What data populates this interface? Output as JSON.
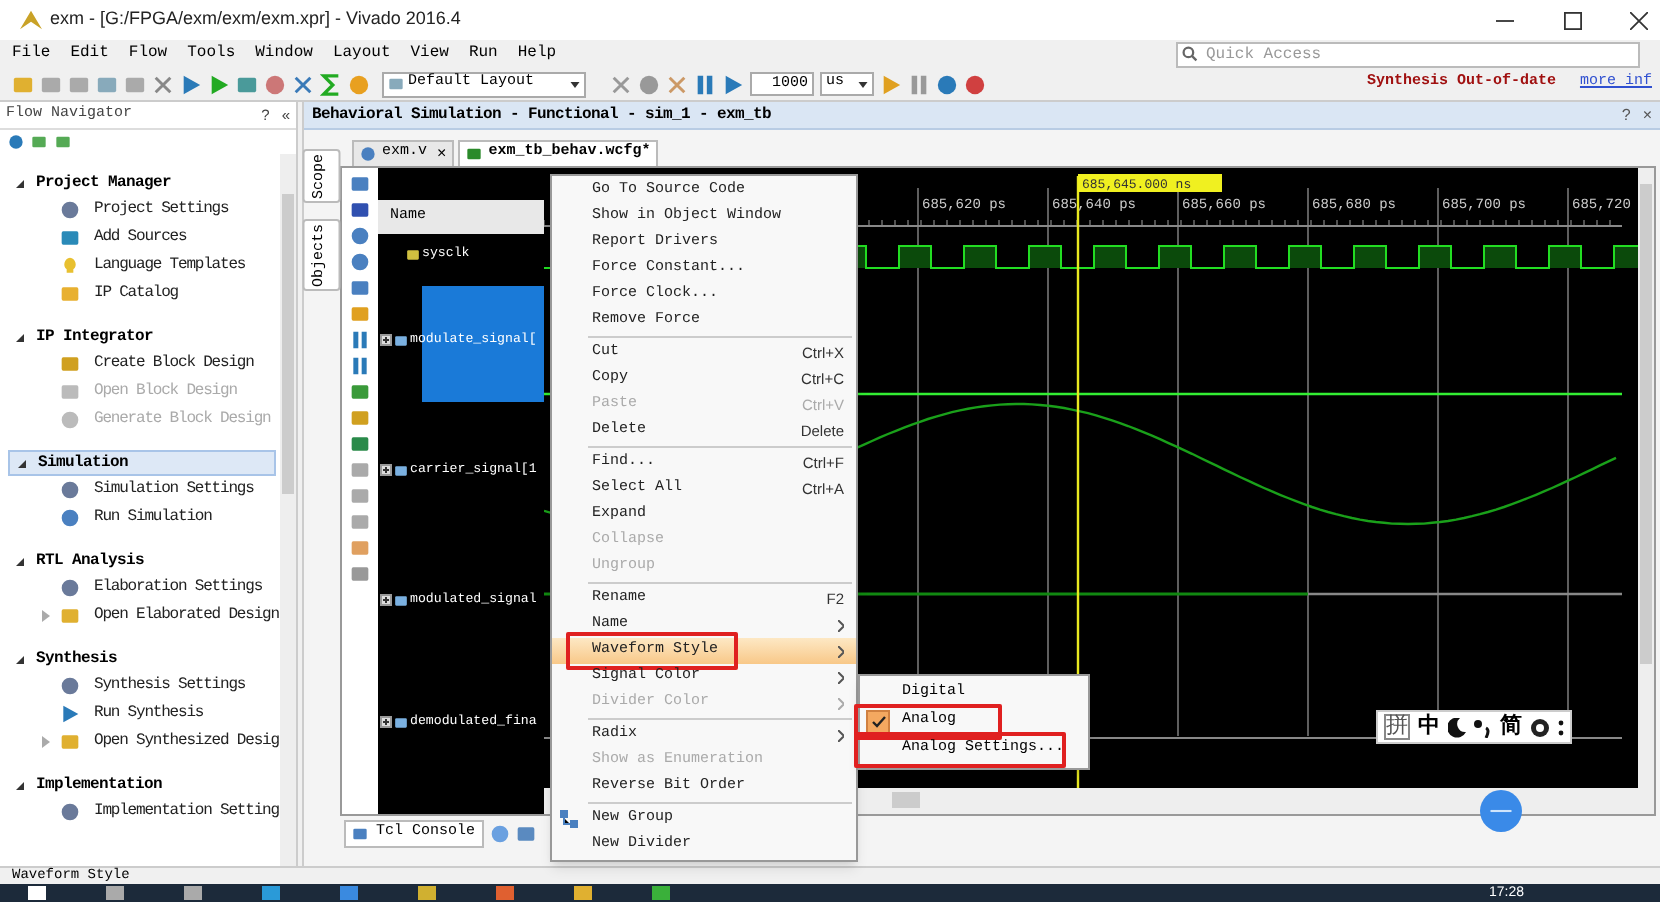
{
  "window": {
    "title": "exm - [G:/FPGA/exm/exm/exm.xpr] - Vivado 2016.4"
  },
  "menu_bar": [
    "File",
    "Edit",
    "Flow",
    "Tools",
    "Window",
    "Layout",
    "View",
    "Run",
    "Help"
  ],
  "quick_access": {
    "placeholder": "Quick Access"
  },
  "toolbar": {
    "layout": "Default Layout",
    "run_time": "1000",
    "run_unit": "us"
  },
  "status_notice": {
    "text": "Synthesis Out-of-date",
    "link": "more inf"
  },
  "flow_navigator": {
    "title": "Flow Navigator",
    "help": "?",
    "collapse": "«",
    "sections": [
      {
        "label": "Project Manager",
        "selected": false,
        "children": [
          {
            "label": "Project Settings",
            "disabled": false,
            "expandable": false
          },
          {
            "label": "Add Sources",
            "disabled": false,
            "expandable": false
          },
          {
            "label": "Language Templates",
            "disabled": false,
            "expandable": false
          },
          {
            "label": "IP Catalog",
            "disabled": false,
            "expandable": false
          }
        ]
      },
      {
        "label": "IP Integrator",
        "selected": false,
        "children": [
          {
            "label": "Create Block Design",
            "disabled": false,
            "expandable": false
          },
          {
            "label": "Open Block Design",
            "disabled": true,
            "expandable": false
          },
          {
            "label": "Generate Block Design",
            "disabled": true,
            "expandable": false
          }
        ]
      },
      {
        "label": "Simulation",
        "selected": true,
        "children": [
          {
            "label": "Simulation Settings",
            "disabled": false,
            "expandable": false
          },
          {
            "label": "Run Simulation",
            "disabled": false,
            "expandable": false
          }
        ]
      },
      {
        "label": "RTL Analysis",
        "selected": false,
        "children": [
          {
            "label": "Elaboration Settings",
            "disabled": false,
            "expandable": false
          },
          {
            "label": "Open Elaborated Design",
            "disabled": false,
            "expandable": true
          }
        ]
      },
      {
        "label": "Synthesis",
        "selected": false,
        "children": [
          {
            "label": "Synthesis Settings",
            "disabled": false,
            "expandable": false
          },
          {
            "label": "Run Synthesis",
            "disabled": false,
            "expandable": false
          },
          {
            "label": "Open Synthesized Desig",
            "disabled": false,
            "expandable": true
          }
        ]
      },
      {
        "label": "Implementation",
        "selected": false,
        "children": [
          {
            "label": "Implementation Setting",
            "disabled": false,
            "expandable": false
          }
        ]
      }
    ]
  },
  "simulation_panel": {
    "title": "Behavioral Simulation - Functional - sim_1 - exm_tb",
    "help": "?",
    "close": "×",
    "side_tabs": [
      "Scope",
      "Objects"
    ],
    "tabs": [
      {
        "label": "exm.v",
        "selected": false,
        "close": "×"
      },
      {
        "label": "exm_tb_behav.wcfg*",
        "selected": true
      }
    ],
    "name_header": "Name",
    "signals": [
      {
        "name": "sysclk",
        "selected": false,
        "expandable": false
      },
      {
        "name": "modulate_signal[",
        "selected": true,
        "expandable": true
      },
      {
        "name": "carrier_signal[1",
        "selected": false,
        "expandable": true
      },
      {
        "name": "modulated_signal",
        "selected": false,
        "expandable": true
      },
      {
        "name": "demodulated_fina",
        "selected": false,
        "expandable": true
      }
    ],
    "cursor_time": "685,645.000 ns",
    "time_ticks": [
      "685,620 ps",
      "685,640 ps",
      "685,660 ps",
      "685,680 ps",
      "685,700 ps",
      "685,720"
    ],
    "bottom_tabs": [
      "Tcl Console"
    ]
  },
  "context_menu": [
    {
      "kind": "item",
      "label": "Go To Source Code",
      "disabled": false,
      "selected": false,
      "annotated": false
    },
    {
      "kind": "item",
      "label": "Show in Object Window",
      "disabled": false,
      "selected": false,
      "annotated": false
    },
    {
      "kind": "item",
      "label": "Report Drivers",
      "disabled": false,
      "selected": false,
      "annotated": false
    },
    {
      "kind": "item",
      "label": "Force Constant...",
      "disabled": false,
      "selected": false,
      "annotated": false
    },
    {
      "kind": "item",
      "label": "Force Clock...",
      "disabled": false,
      "selected": false,
      "annotated": false
    },
    {
      "kind": "item",
      "label": "Remove Force",
      "disabled": false,
      "selected": false,
      "annotated": false
    },
    {
      "kind": "separator"
    },
    {
      "kind": "item",
      "label": "Cut",
      "shortcut": "Ctrl+X",
      "disabled": false,
      "selected": false,
      "annotated": false
    },
    {
      "kind": "item",
      "label": "Copy",
      "shortcut": "Ctrl+C",
      "disabled": false,
      "selected": false,
      "annotated": false
    },
    {
      "kind": "item",
      "label": "Paste",
      "shortcut": "Ctrl+V",
      "disabled": true,
      "selected": false,
      "annotated": false
    },
    {
      "kind": "item",
      "label": "Delete",
      "shortcut": "Delete",
      "disabled": false,
      "selected": false,
      "annotated": false
    },
    {
      "kind": "separator"
    },
    {
      "kind": "item",
      "label": "Find...",
      "shortcut": "Ctrl+F",
      "disabled": false,
      "selected": false,
      "annotated": false
    },
    {
      "kind": "item",
      "label": "Select All",
      "shortcut": "Ctrl+A",
      "disabled": false,
      "selected": false,
      "annotated": false
    },
    {
      "kind": "item",
      "label": "Expand",
      "disabled": false,
      "selected": false,
      "annotated": false
    },
    {
      "kind": "item",
      "label": "Collapse",
      "disabled": true,
      "selected": false,
      "annotated": false
    },
    {
      "kind": "item",
      "label": "Ungroup",
      "disabled": true,
      "selected": false,
      "annotated": false
    },
    {
      "kind": "separator"
    },
    {
      "kind": "item",
      "label": "Rename",
      "shortcut": "F2",
      "disabled": false,
      "selected": false,
      "annotated": false
    },
    {
      "kind": "submenu",
      "label": "Name",
      "disabled": false,
      "selected": false,
      "annotated": false
    },
    {
      "kind": "submenu",
      "label": "Waveform Style",
      "disabled": false,
      "selected": true,
      "annotated": true
    },
    {
      "kind": "submenu",
      "label": "Signal Color",
      "disabled": false,
      "selected": false,
      "annotated": false
    },
    {
      "kind": "submenu",
      "label": "Divider Color",
      "disabled": true,
      "selected": false,
      "annotated": false
    },
    {
      "kind": "separator"
    },
    {
      "kind": "submenu",
      "label": "Radix",
      "disabled": false,
      "selected": false,
      "annotated": false
    },
    {
      "kind": "item",
      "label": "Show as Enumeration",
      "disabled": true,
      "selected": false,
      "annotated": false
    },
    {
      "kind": "item",
      "label": "Reverse Bit Order",
      "disabled": false,
      "selected": false,
      "annotated": false
    },
    {
      "kind": "separator"
    },
    {
      "kind": "item",
      "label": "New Group",
      "disabled": false,
      "selected": false,
      "annotated": false,
      "icon": true
    },
    {
      "kind": "item",
      "label": "New Divider",
      "disabled": false,
      "selected": false,
      "annotated": false
    }
  ],
  "submenu": [
    {
      "label": "Digital",
      "checked": false,
      "annotated": false
    },
    {
      "label": "Analog",
      "checked": true,
      "annotated": true
    },
    {
      "label": "Analog Settings...",
      "checked": false,
      "annotated": true
    }
  ],
  "ime_toolbar": [
    "拼",
    "中",
    "简"
  ],
  "status_bar": "Waveform Style",
  "taskbar": {
    "clock": "17:28"
  }
}
